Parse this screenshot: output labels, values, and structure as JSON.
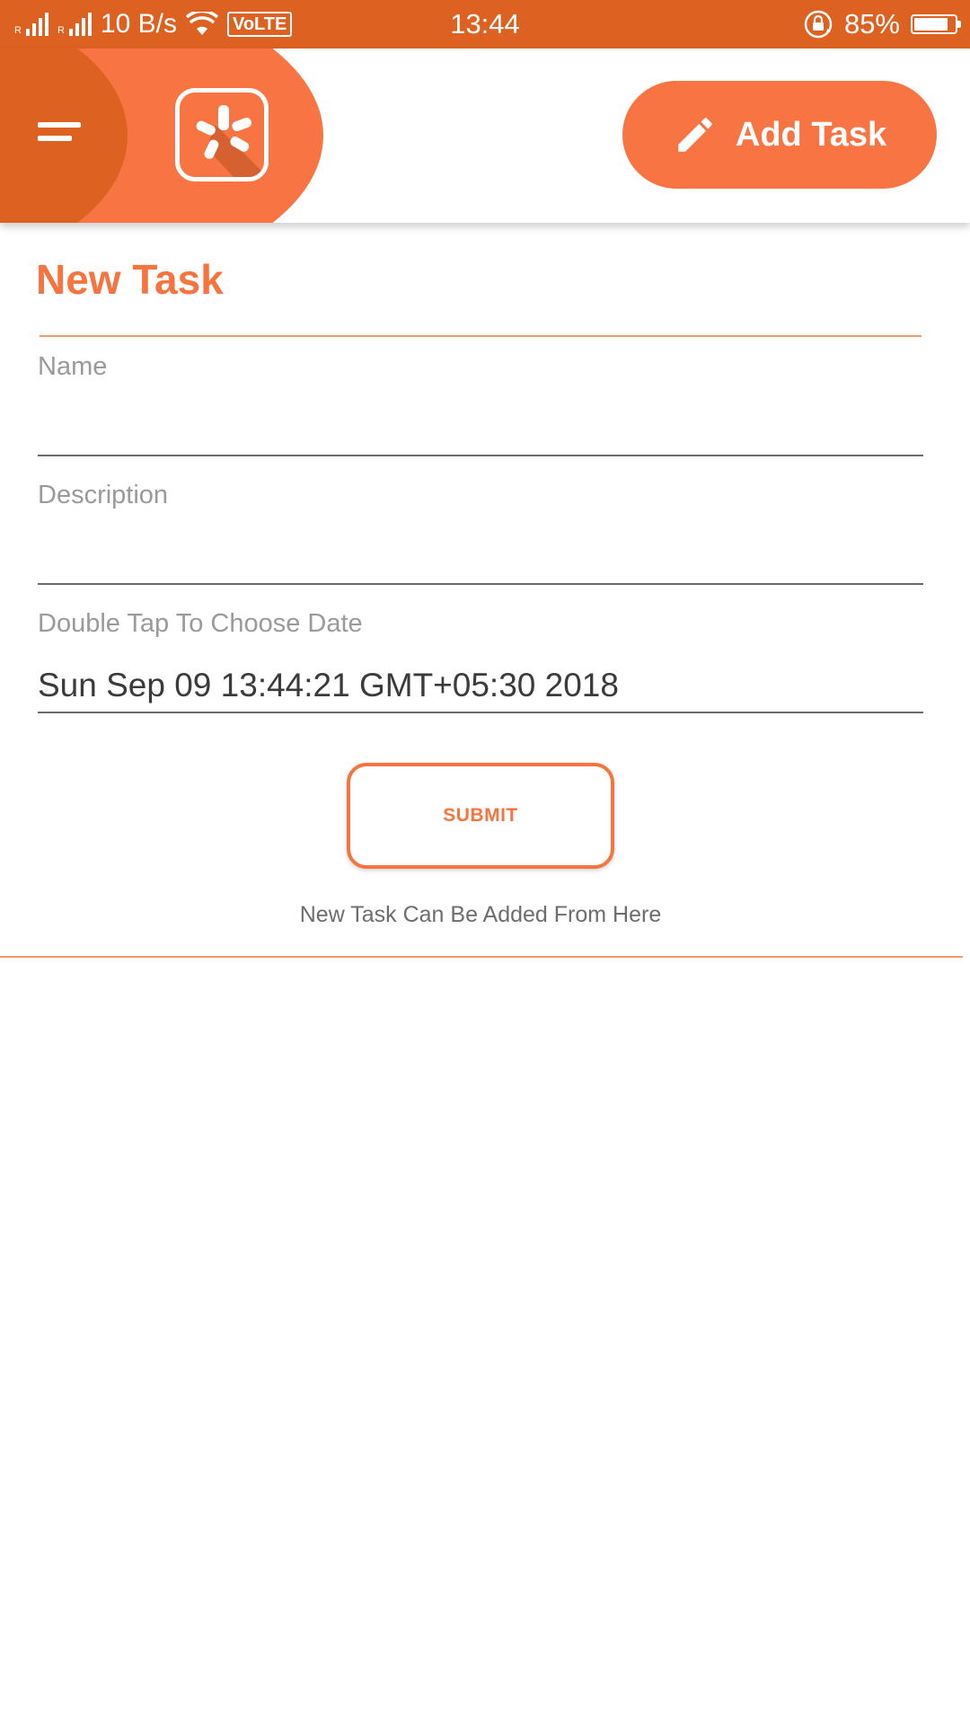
{
  "status_bar": {
    "signal_1_label": "R",
    "signal_2_label": "R",
    "network_speed": "10 B/s",
    "volte": "VoLTE",
    "time": "13:44",
    "battery_percent": "85%",
    "battery_level": 0.85,
    "icons": [
      "signal-icon",
      "signal-icon",
      "wifi-icon",
      "rotation-lock-icon",
      "battery-icon"
    ]
  },
  "toolbar": {
    "menu_icon": "menu-icon",
    "logo_icon": "yelp-burst-logo",
    "add_task_label": "Add Task",
    "add_task_icon": "pencil-icon"
  },
  "form": {
    "title": "New Task",
    "name_label": "Name",
    "name_value": "",
    "description_label": "Description",
    "description_value": "",
    "date_label": "Double Tap To Choose Date",
    "date_value": "Sun Sep 09 13:44:21 GMT+05:30 2018",
    "submit_label": "SUBMIT",
    "hint": "New Task Can Be Added From Here"
  },
  "colors": {
    "primary_dark": "#dd6121",
    "primary": "#f87442",
    "accent_text": "#f5743f",
    "divider": "#f5996b"
  }
}
